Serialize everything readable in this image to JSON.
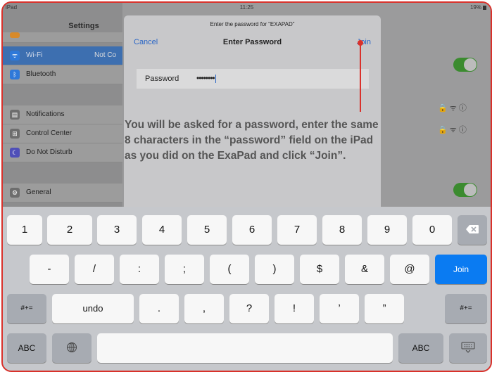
{
  "status_bar": {
    "carrier": "iPad",
    "time": "11:25",
    "battery": "19%"
  },
  "settings": {
    "title": "Settings",
    "items": [
      {
        "label": "Wi-Fi",
        "value": "Not Co",
        "icon": "wifi-icon",
        "color": "#2f79d9"
      },
      {
        "label": "Bluetooth",
        "value": "",
        "icon": "bluetooth-icon",
        "color": "#2f79d9"
      },
      {
        "label": "Notifications",
        "value": "",
        "icon": "notifications-icon",
        "color": "#6d6d6d"
      },
      {
        "label": "Control Center",
        "value": "",
        "icon": "control-center-icon",
        "color": "#6d6d6d"
      },
      {
        "label": "Do Not Disturb",
        "value": "",
        "icon": "moon-icon",
        "color": "#4f4fb8"
      },
      {
        "label": "General",
        "value": "",
        "icon": "gear-icon",
        "color": "#6d6d6d"
      }
    ]
  },
  "networks": {
    "secured": "🔒 ᯤ ⓘ"
  },
  "dialog": {
    "prompt": "Enter the password for “EXAPAD”",
    "cancel_label": "Cancel",
    "title": "Enter Password",
    "join_label": "Join",
    "password_label": "Password",
    "password_value": "••••••••"
  },
  "callout": {
    "text": "You will be asked for a password, enter the same 8 characters in the “password” field on the iPad as you did on the ExaPad and click “Join”."
  },
  "keyboard": {
    "row1": [
      "1",
      "2",
      "3",
      "4",
      "5",
      "6",
      "7",
      "8",
      "9",
      "0"
    ],
    "row2": [
      "-",
      "/",
      ":",
      ";",
      "(",
      ")",
      "$",
      "&",
      "@"
    ],
    "row2_action": "Join",
    "row3": [
      ".",
      ",",
      "?",
      "!",
      "’",
      "”"
    ],
    "shift_label": "#+=",
    "undo_label": "undo",
    "abc_label": "ABC",
    "backspace_icon": "backspace-icon",
    "globe_icon": "globe-icon",
    "hide_keyboard_icon": "keyboard-hide-icon"
  },
  "colors": {
    "accent": "#2a66c6",
    "callout": "#d9312b",
    "join_key": "#0a7bf2",
    "toggle_on": "#3b8b2f"
  }
}
